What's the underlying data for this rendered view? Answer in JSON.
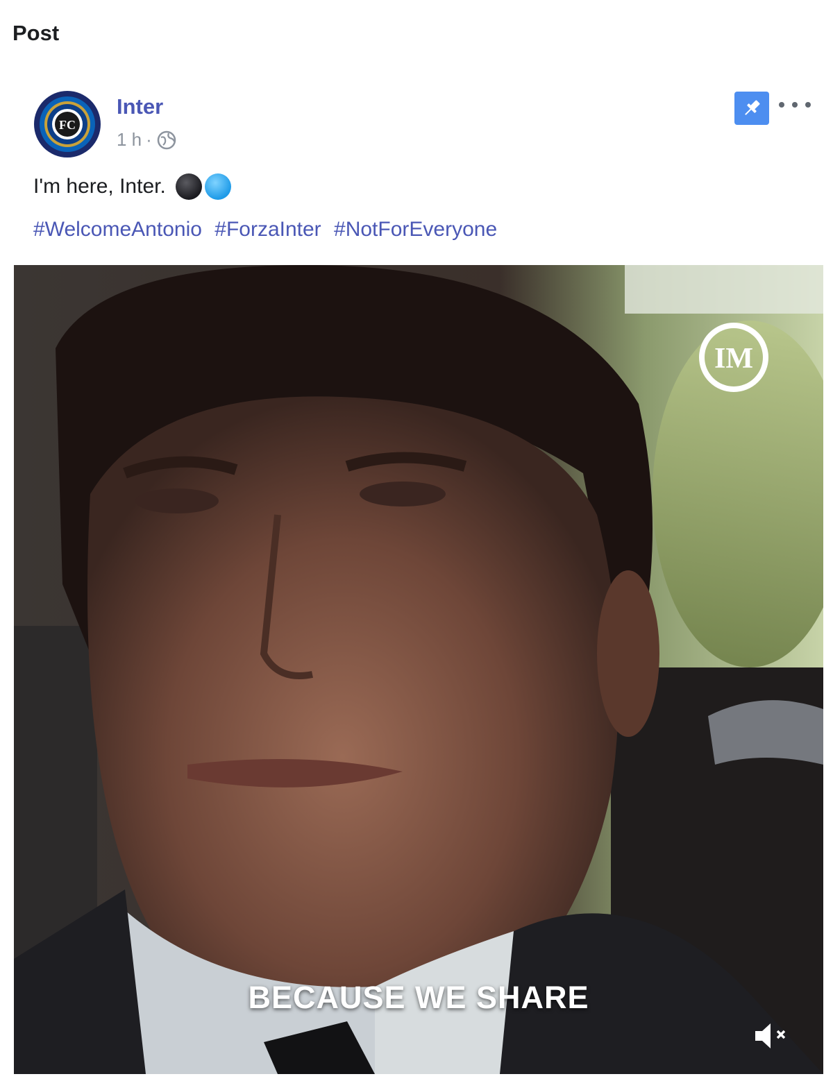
{
  "header": {
    "title": "Post"
  },
  "post": {
    "page_name": "Inter",
    "timestamp": "1 h",
    "separator": "·",
    "audience_icon": "globe-icon",
    "text": "I'm here, Inter.",
    "emojis": [
      "black-circle",
      "blue-circle"
    ],
    "hashtags": [
      "#WelcomeAntonio",
      "#ForzaInter",
      "#NotForEveryone"
    ],
    "actions": {
      "pin_icon": "pin-icon",
      "more_icon": "more-options-icon"
    },
    "colors": {
      "link": "#4a57b5",
      "pin": "#4d8ef0"
    }
  },
  "video": {
    "caption": "BECAUSE WE SHARE",
    "watermark_icon": "inter-logo-icon",
    "mute_icon": "mute-icon"
  }
}
